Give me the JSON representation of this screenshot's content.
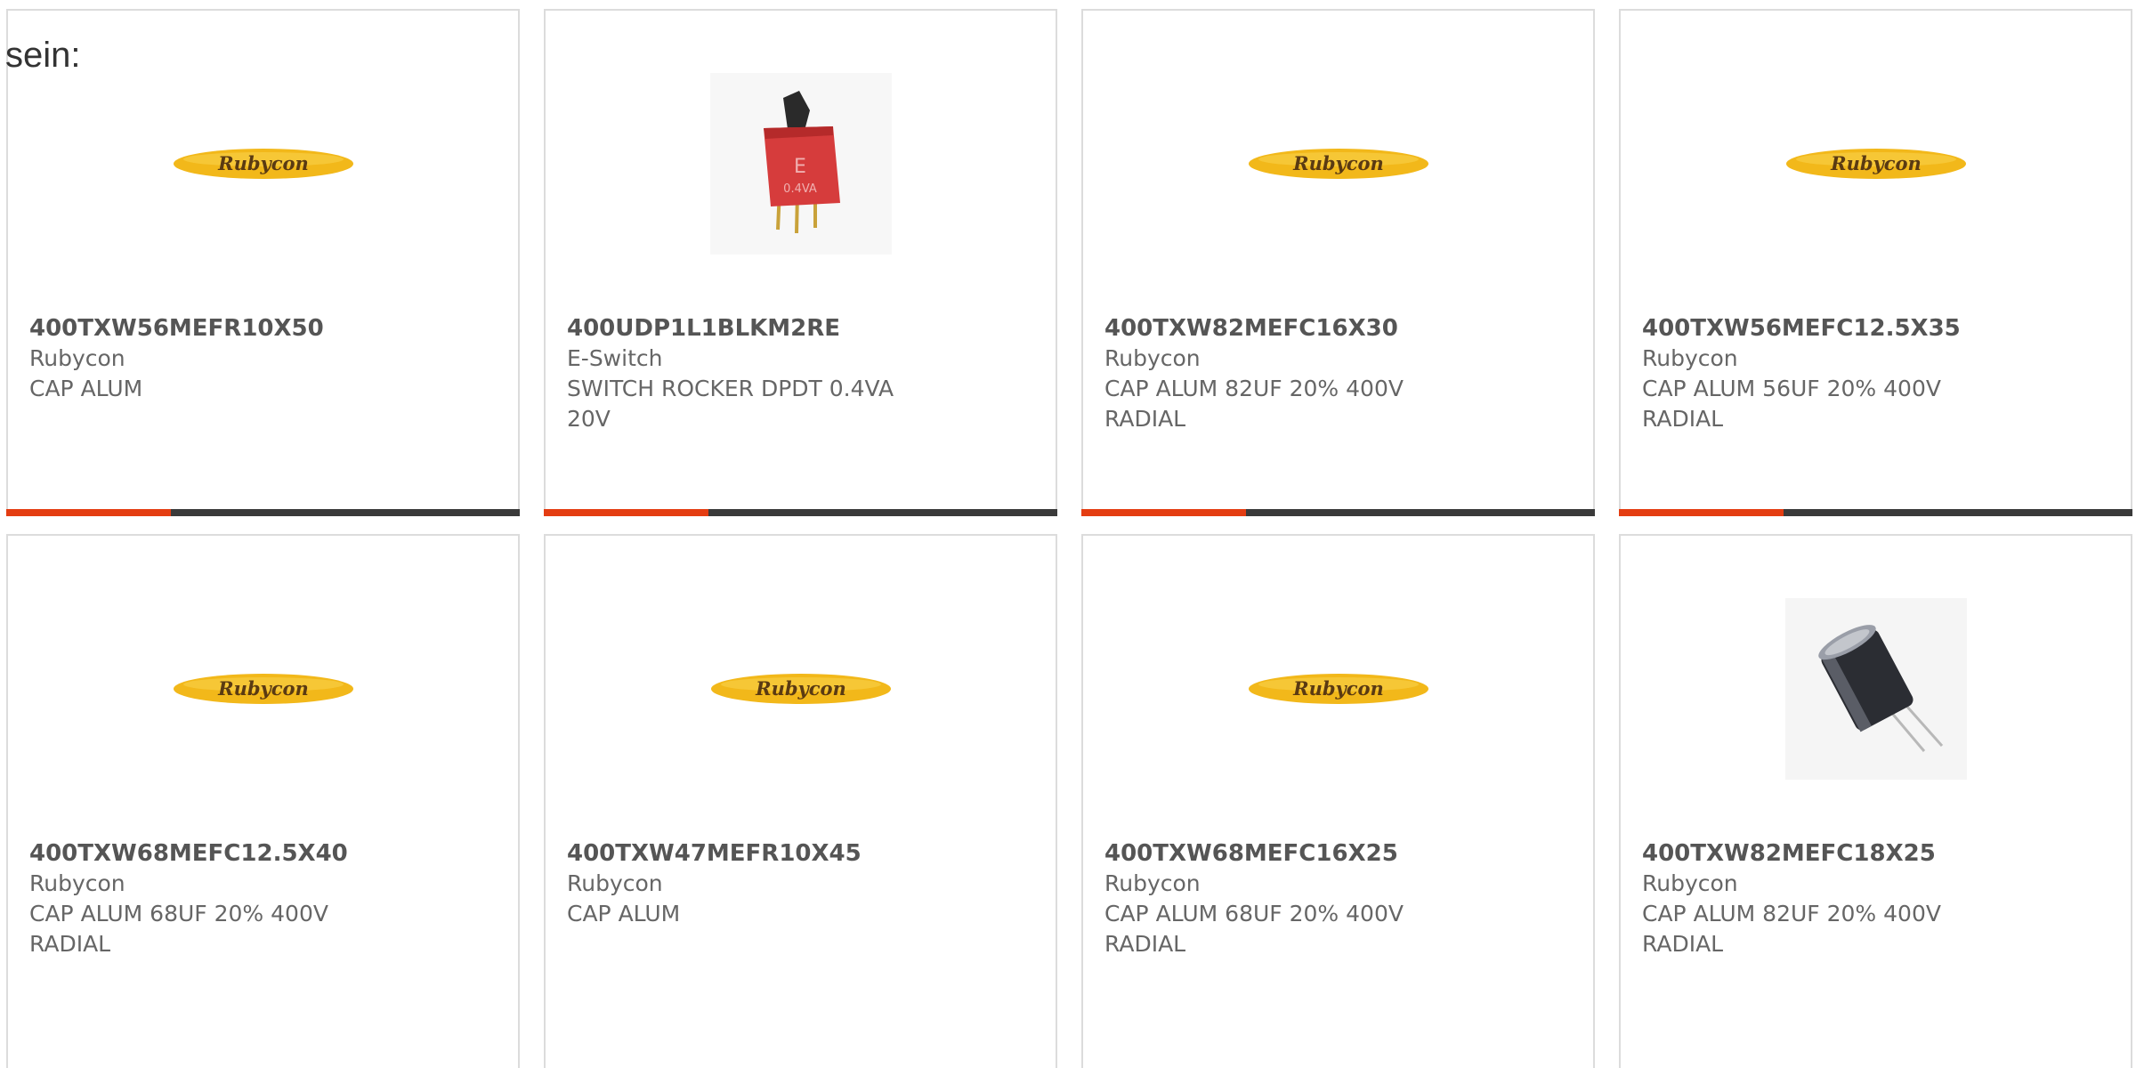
{
  "intro_text": "sein:",
  "colors": {
    "accent": "#e43d12",
    "bar_track": "#3a3a3a",
    "logo_yellow": "#f2b81a",
    "logo_text": "#5a3a12"
  },
  "logo_text": "Rubycon",
  "switch_marking": {
    "letter": "E",
    "rating": "0.4VA"
  },
  "products": [
    {
      "part_number": "400TXW56MEFR10X50",
      "manufacturer": "Rubycon",
      "description": "CAP ALUM",
      "image": "rubycon-logo",
      "progress_fraction": 0.32
    },
    {
      "part_number": "400UDP1L1BLKM2RE",
      "manufacturer": "E-Switch",
      "description": "SWITCH ROCKER DPDT 0.4VA 20V",
      "image": "rocker-switch-photo",
      "progress_fraction": 0.32
    },
    {
      "part_number": "400TXW82MEFC16X30",
      "manufacturer": "Rubycon",
      "description": "CAP ALUM 82UF 20% 400V RADIAL",
      "image": "rubycon-logo",
      "progress_fraction": 0.32
    },
    {
      "part_number": "400TXW56MEFC12.5X35",
      "manufacturer": "Rubycon",
      "description": "CAP ALUM 56UF 20% 400V RADIAL",
      "image": "rubycon-logo",
      "progress_fraction": 0.32
    },
    {
      "part_number": "400TXW68MEFC12.5X40",
      "manufacturer": "Rubycon",
      "description": "CAP ALUM 68UF 20% 400V RADIAL",
      "image": "rubycon-logo"
    },
    {
      "part_number": "400TXW47MEFR10X45",
      "manufacturer": "Rubycon",
      "description": "CAP ALUM",
      "image": "rubycon-logo"
    },
    {
      "part_number": "400TXW68MEFC16X25",
      "manufacturer": "Rubycon",
      "description": "CAP ALUM 68UF 20% 400V RADIAL",
      "image": "rubycon-logo"
    },
    {
      "part_number": "400TXW82MEFC18X25",
      "manufacturer": "Rubycon",
      "description": "CAP ALUM 82UF 20% 400V RADIAL",
      "image": "capacitor-photo"
    }
  ]
}
